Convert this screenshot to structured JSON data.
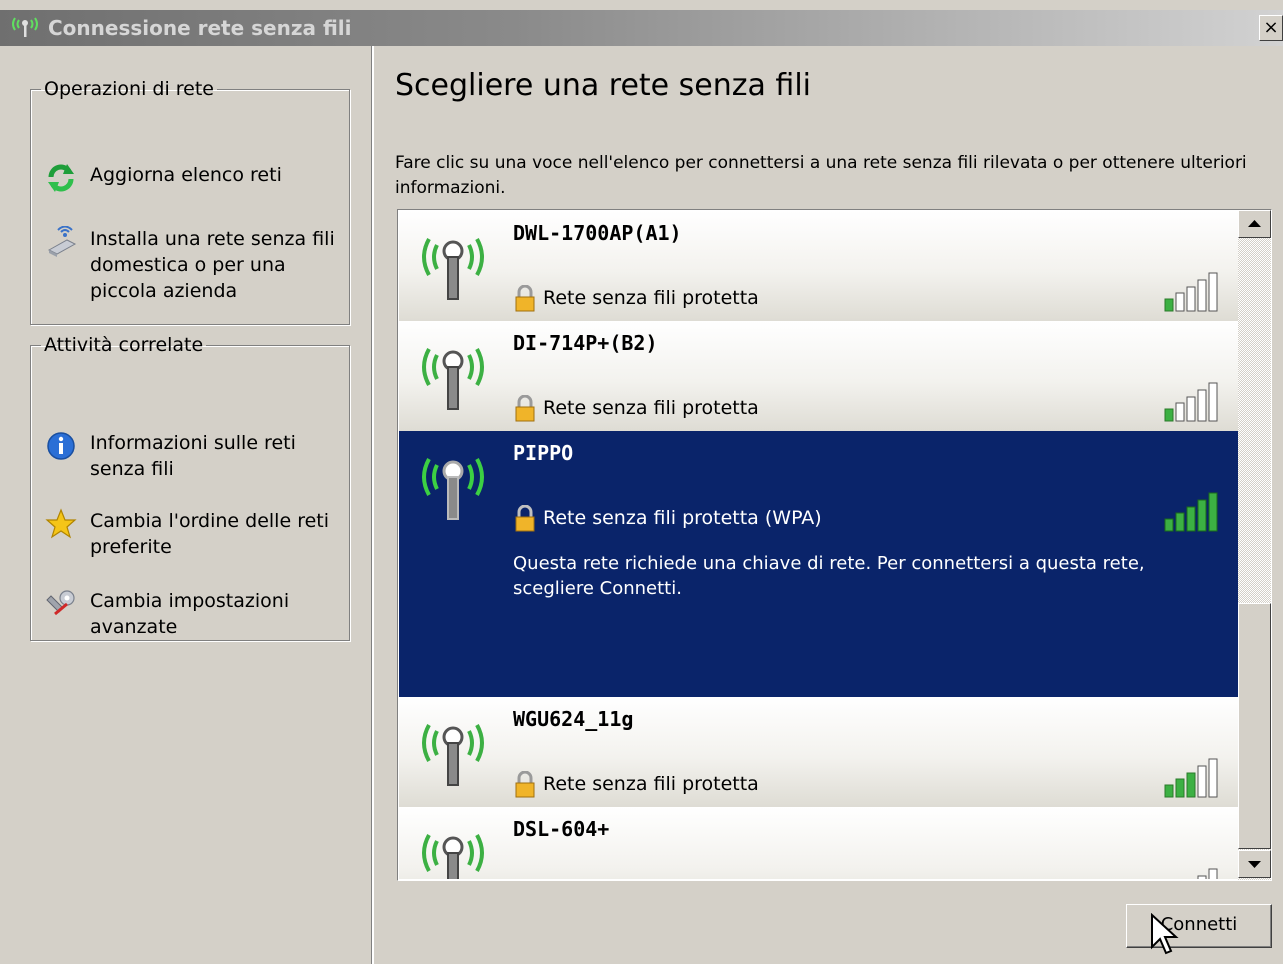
{
  "window": {
    "title": "Connessione rete senza fili",
    "close_label": "×"
  },
  "sidebar": {
    "network_tasks": {
      "title": "Operazioni di rete",
      "items": [
        {
          "label": "Aggiorna elenco reti",
          "icon": "refresh-icon"
        },
        {
          "label": "Installa una rete senza fili domestica o per una piccola azienda",
          "icon": "wireless-setup-icon"
        }
      ]
    },
    "related_tasks": {
      "title": "Attività correlate",
      "items": [
        {
          "label": "Informazioni sulle reti senza fili",
          "icon": "info-icon"
        },
        {
          "label": "Cambia l'ordine delle reti preferite",
          "icon": "star-icon"
        },
        {
          "label": "Cambia impostazioni avanzate",
          "icon": "advanced-settings-icon"
        }
      ]
    }
  },
  "main": {
    "heading": "Scegliere una rete senza fili",
    "instructions": "Fare clic su una voce nell'elenco per connettersi a una rete senza fili rilevata o per ottenere ulteriori informazioni.",
    "networks": [
      {
        "ssid": "DWL-1700AP(A1)",
        "security": "Rete senza fili protetta",
        "signal_bars": 1,
        "selected": false
      },
      {
        "ssid": "DI-714P+(B2)",
        "security": "Rete senza fili protetta",
        "signal_bars": 1,
        "selected": false
      },
      {
        "ssid": "PIPPO",
        "security": "Rete senza fili protetta (WPA)",
        "signal_bars": 5,
        "selected": true,
        "description": "Questa rete richiede una chiave di rete. Per connettersi a questa rete, scegliere Connetti."
      },
      {
        "ssid": "WGU624_11g",
        "security": "Rete senza fili protetta",
        "signal_bars": 3,
        "selected": false
      },
      {
        "ssid": "DSL-604+",
        "security": "",
        "signal_bars": 1,
        "selected": false
      }
    ],
    "connect_label": "Connetti"
  },
  "colors": {
    "selection": "#0a246a",
    "signal_on": "#3cb043",
    "signal_off": "#ffffff",
    "dialog_face": "#d4d0c8"
  }
}
